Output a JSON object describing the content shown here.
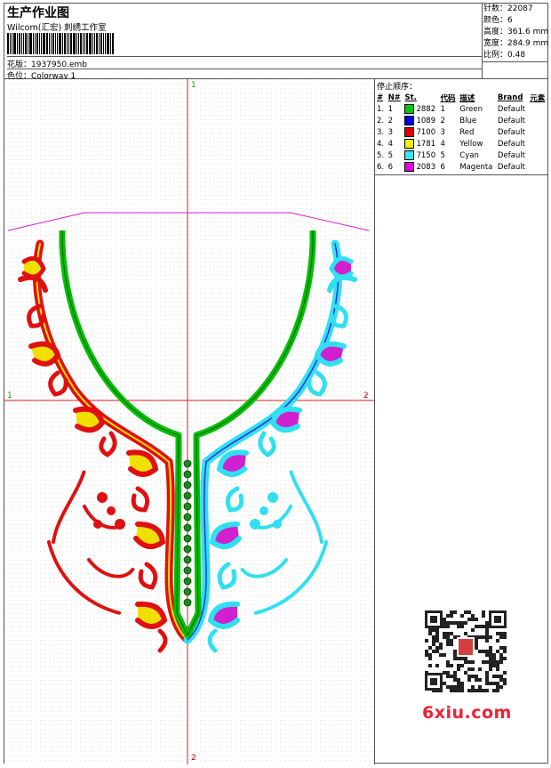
{
  "header": {
    "title": "生产作业图",
    "subtitle": "Wilcom(汇宏) 刺绣工作室",
    "design_line": "花版：1937950.emb",
    "colorway_line": "色位：Colorway 1"
  },
  "stats": {
    "stitches": "针数：22087",
    "colors": "颜色：6",
    "height": "高度：361.6 mm",
    "width": "宽度：284.9 mm",
    "scale": "比例：0.48"
  },
  "panel": {
    "title": "停止顺序：",
    "columns": [
      "#",
      "N#",
      "St.",
      "代码",
      "描述",
      "Brand",
      "元素"
    ],
    "rows": [
      {
        "n": "1.",
        "nn": "1",
        "code": "2882",
        "seq": "1",
        "desc": "Green",
        "brand": "Default",
        "color": "#00c800"
      },
      {
        "n": "2.",
        "nn": "2",
        "code": "1089",
        "seq": "2",
        "desc": "Blue",
        "brand": "Default",
        "color": "#0000e0"
      },
      {
        "n": "3.",
        "nn": "3",
        "code": "7100",
        "seq": "3",
        "desc": "Red",
        "brand": "Default",
        "color": "#e00000"
      },
      {
        "n": "4.",
        "nn": "4",
        "code": "1781",
        "seq": "4",
        "desc": "Yellow",
        "brand": "Default",
        "color": "#f0f000"
      },
      {
        "n": "5.",
        "nn": "5",
        "code": "7150",
        "seq": "5",
        "desc": "Cyan",
        "brand": "Default",
        "color": "#30e8f0"
      },
      {
        "n": "6.",
        "nn": "6",
        "code": "2083",
        "seq": "6",
        "desc": "Magenta",
        "brand": "Default",
        "color": "#e000e0"
      }
    ]
  },
  "markers": {
    "top": "1",
    "left": "1",
    "right": "2",
    "bottom": "2"
  },
  "watermark": {
    "logo": "6xiu.com"
  }
}
